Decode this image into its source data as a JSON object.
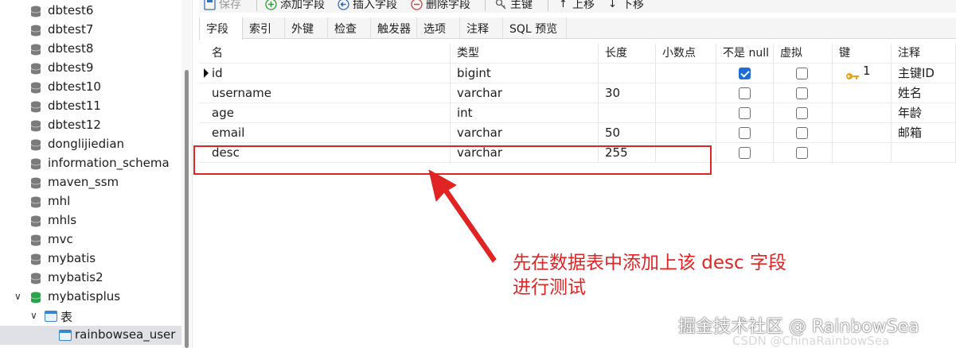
{
  "sidebar": {
    "items": [
      {
        "label": "dbtest6"
      },
      {
        "label": "dbtest7"
      },
      {
        "label": "dbtest8"
      },
      {
        "label": "dbtest9"
      },
      {
        "label": "dbtest10"
      },
      {
        "label": "dbtest11"
      },
      {
        "label": "dbtest12"
      },
      {
        "label": "donglijiedian"
      },
      {
        "label": "information_schema"
      },
      {
        "label": "maven_ssm"
      },
      {
        "label": "mhl"
      },
      {
        "label": "mhls"
      },
      {
        "label": "mvc"
      },
      {
        "label": "mybatis"
      },
      {
        "label": "mybatis2"
      },
      {
        "label": "mybatisplus"
      }
    ],
    "tables_node": {
      "label": "表"
    },
    "selected_table": {
      "label": "rainbowsea_user"
    }
  },
  "toolbar": {
    "save": "保存",
    "add_field": "添加字段",
    "insert_field": "插入字段",
    "delete_field": "删除字段",
    "primary_key": "主键",
    "move_up": "上移",
    "move_down": "下移"
  },
  "tabs": [
    "字段",
    "索引",
    "外键",
    "检查",
    "触发器",
    "选项",
    "注释",
    "SQL 预览"
  ],
  "grid": {
    "headers": [
      "名",
      "类型",
      "长度",
      "小数点",
      "不是 null",
      "虚拟",
      "键",
      "注释"
    ],
    "rows": [
      {
        "name": "id",
        "type": "bigint",
        "length": "",
        "decimal": "",
        "not_null": true,
        "virtual": false,
        "key": "1",
        "comment": "主键ID"
      },
      {
        "name": "username",
        "type": "varchar",
        "length": "30",
        "decimal": "",
        "not_null": false,
        "virtual": false,
        "key": "",
        "comment": "姓名"
      },
      {
        "name": "age",
        "type": "int",
        "length": "",
        "decimal": "",
        "not_null": false,
        "virtual": false,
        "key": "",
        "comment": "年龄"
      },
      {
        "name": "email",
        "type": "varchar",
        "length": "50",
        "decimal": "",
        "not_null": false,
        "virtual": false,
        "key": "",
        "comment": "邮箱"
      },
      {
        "name": "desc",
        "type": "varchar",
        "length": "255",
        "decimal": "",
        "not_null": false,
        "virtual": false,
        "key": "",
        "comment": ""
      }
    ]
  },
  "annotation": {
    "line1": "先在数据表中添加上该 desc 字段",
    "line2": "进行测试",
    "color": "#e02424"
  },
  "watermark": {
    "line1": "掘金技术社区 @ RainbowSea",
    "line2": "CSDN @ChinaRainbowSea"
  }
}
